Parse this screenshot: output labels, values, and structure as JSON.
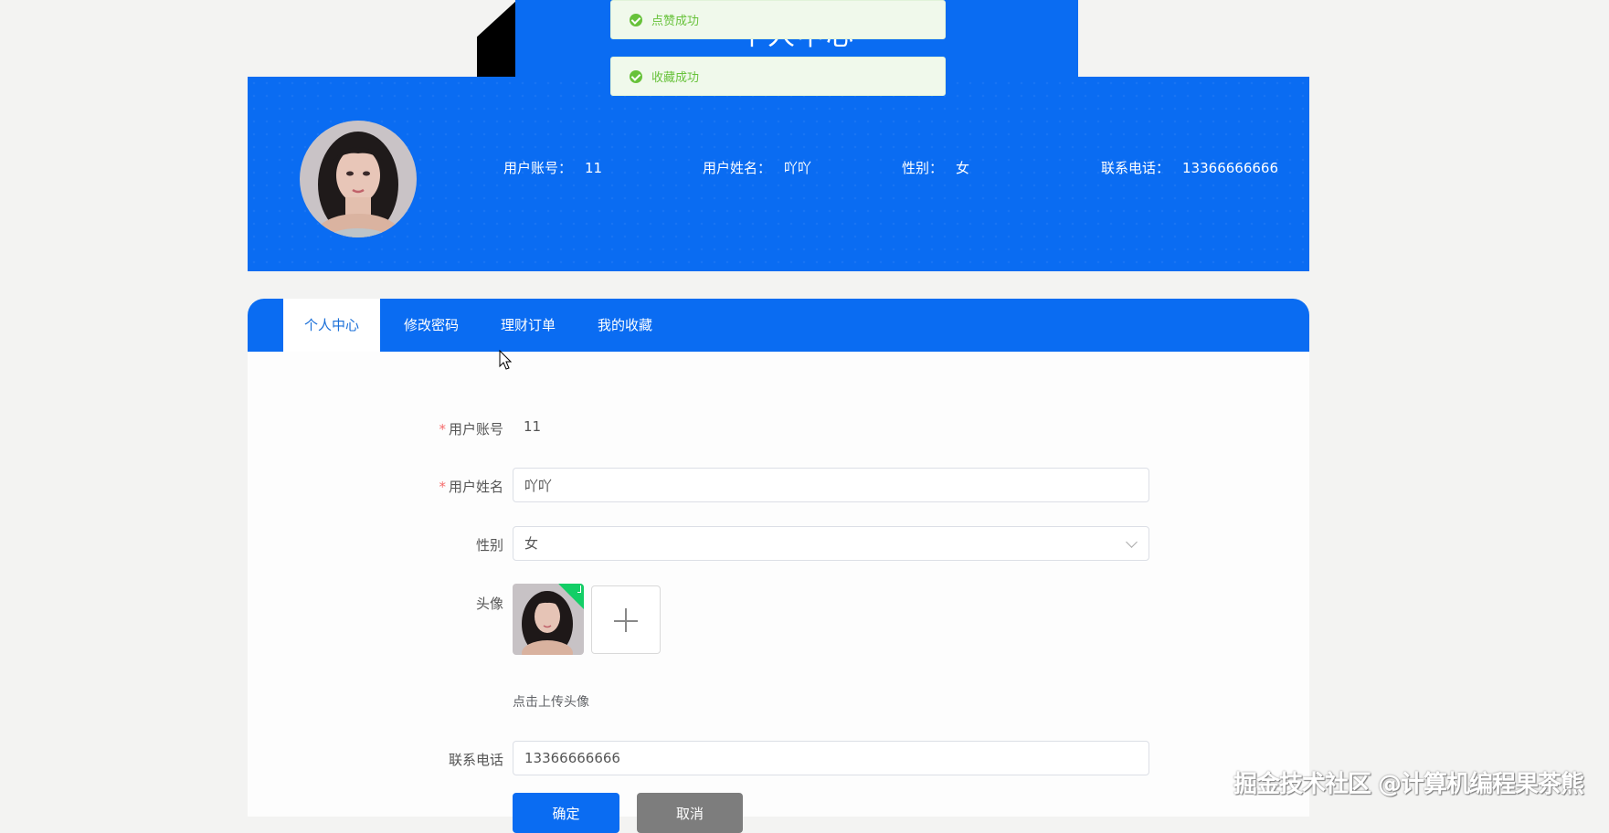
{
  "page_title": "个人中心",
  "toasts": [
    "点赞成功",
    "收藏成功"
  ],
  "profile": {
    "account_label": "用户账号：",
    "account_value": "11",
    "name_label": "用户姓名：",
    "name_value": "吖吖",
    "gender_label": "性别：",
    "gender_value": "女",
    "phone_label": "联系电话：",
    "phone_value": "13366666666"
  },
  "tabs": [
    {
      "label": "个人中心",
      "active": true
    },
    {
      "label": "修改密码",
      "active": false
    },
    {
      "label": "理财订单",
      "active": false
    },
    {
      "label": "我的收藏",
      "active": false
    }
  ],
  "form": {
    "required_mark": "*",
    "account_label": "用户账号",
    "account_value": "11",
    "name_label": "用户姓名",
    "name_value": "吖吖",
    "gender_label": "性别",
    "gender_value": "女",
    "avatar_label": "头像",
    "upload_hint": "点击上传头像",
    "phone_label": "联系电话",
    "phone_value": "13366666666",
    "confirm_label": "确定",
    "cancel_label": "取消"
  },
  "watermark": "掘金技术社区 @计算机编程果茶熊",
  "colors": {
    "primary": "#0a6cf2",
    "success": "#67c23a",
    "cancel": "#7d7d7d"
  }
}
